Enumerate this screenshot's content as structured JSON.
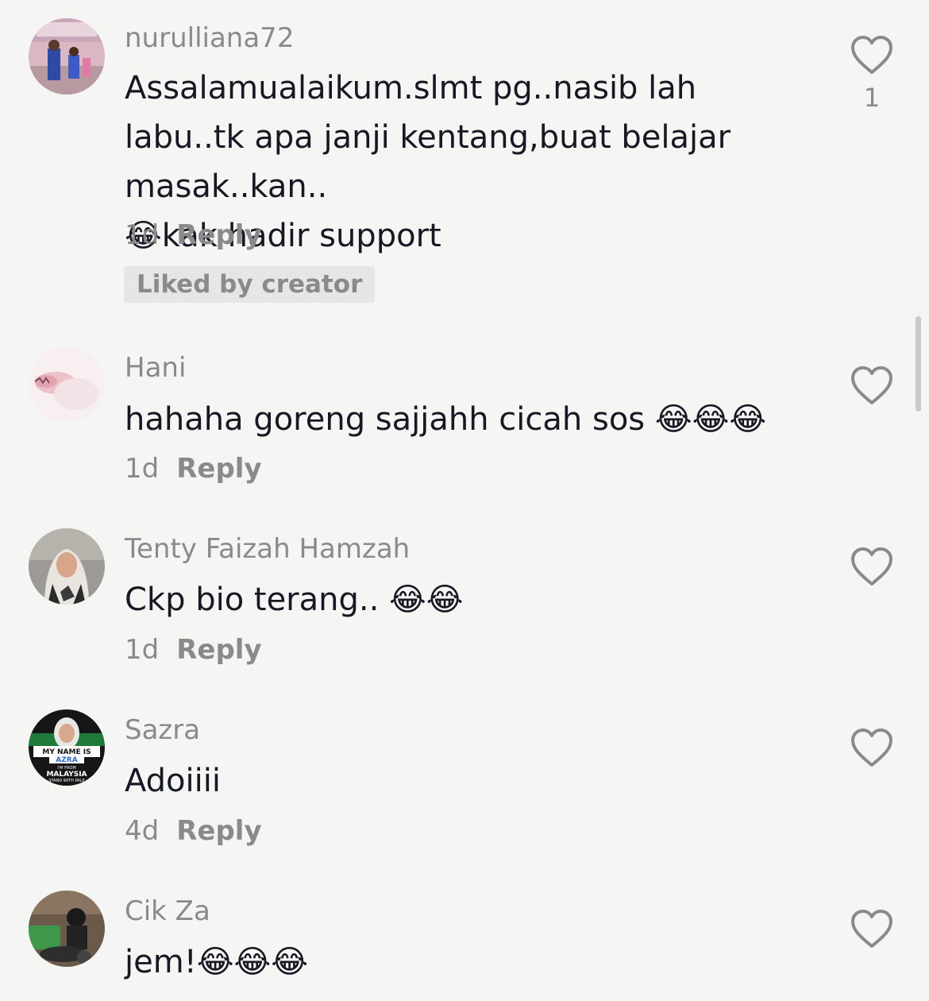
{
  "comments": [
    {
      "username": "nurulliana72",
      "text": "Assalamualaikum.slmt pg..nasib lah labu..tk apa janji kentang,buat belajar masak..kan..\n😂kak hadir support",
      "time": "1d",
      "reply_label": "Reply",
      "like_count": "1",
      "liked_by_creator": "Liked by creator"
    },
    {
      "username": "Hani",
      "text": "hahaha goreng sajjahh cicah sos 😂😂😂",
      "time": "1d",
      "reply_label": "Reply"
    },
    {
      "username": "Tenty Faizah Hamzah",
      "text": "Ckp bio terang.. 😂😂",
      "time": "1d",
      "reply_label": "Reply"
    },
    {
      "username": "Sazra",
      "text": "Adoiiii",
      "time": "4d",
      "reply_label": "Reply",
      "avatar_text": [
        "MY NAME IS",
        "AZRA",
        "I'M FROM",
        "MALAYSIA",
        "STAND WITH PALE"
      ]
    },
    {
      "username": "Cik Za",
      "text": "jem!😂😂😂"
    }
  ],
  "icons": {
    "like": "heart-outline-icon"
  },
  "colors": {
    "background": "#f5f5f4",
    "text": "#161823",
    "secondary_text": "#8a8a8a",
    "badge_bg": "#e6e6e6"
  }
}
